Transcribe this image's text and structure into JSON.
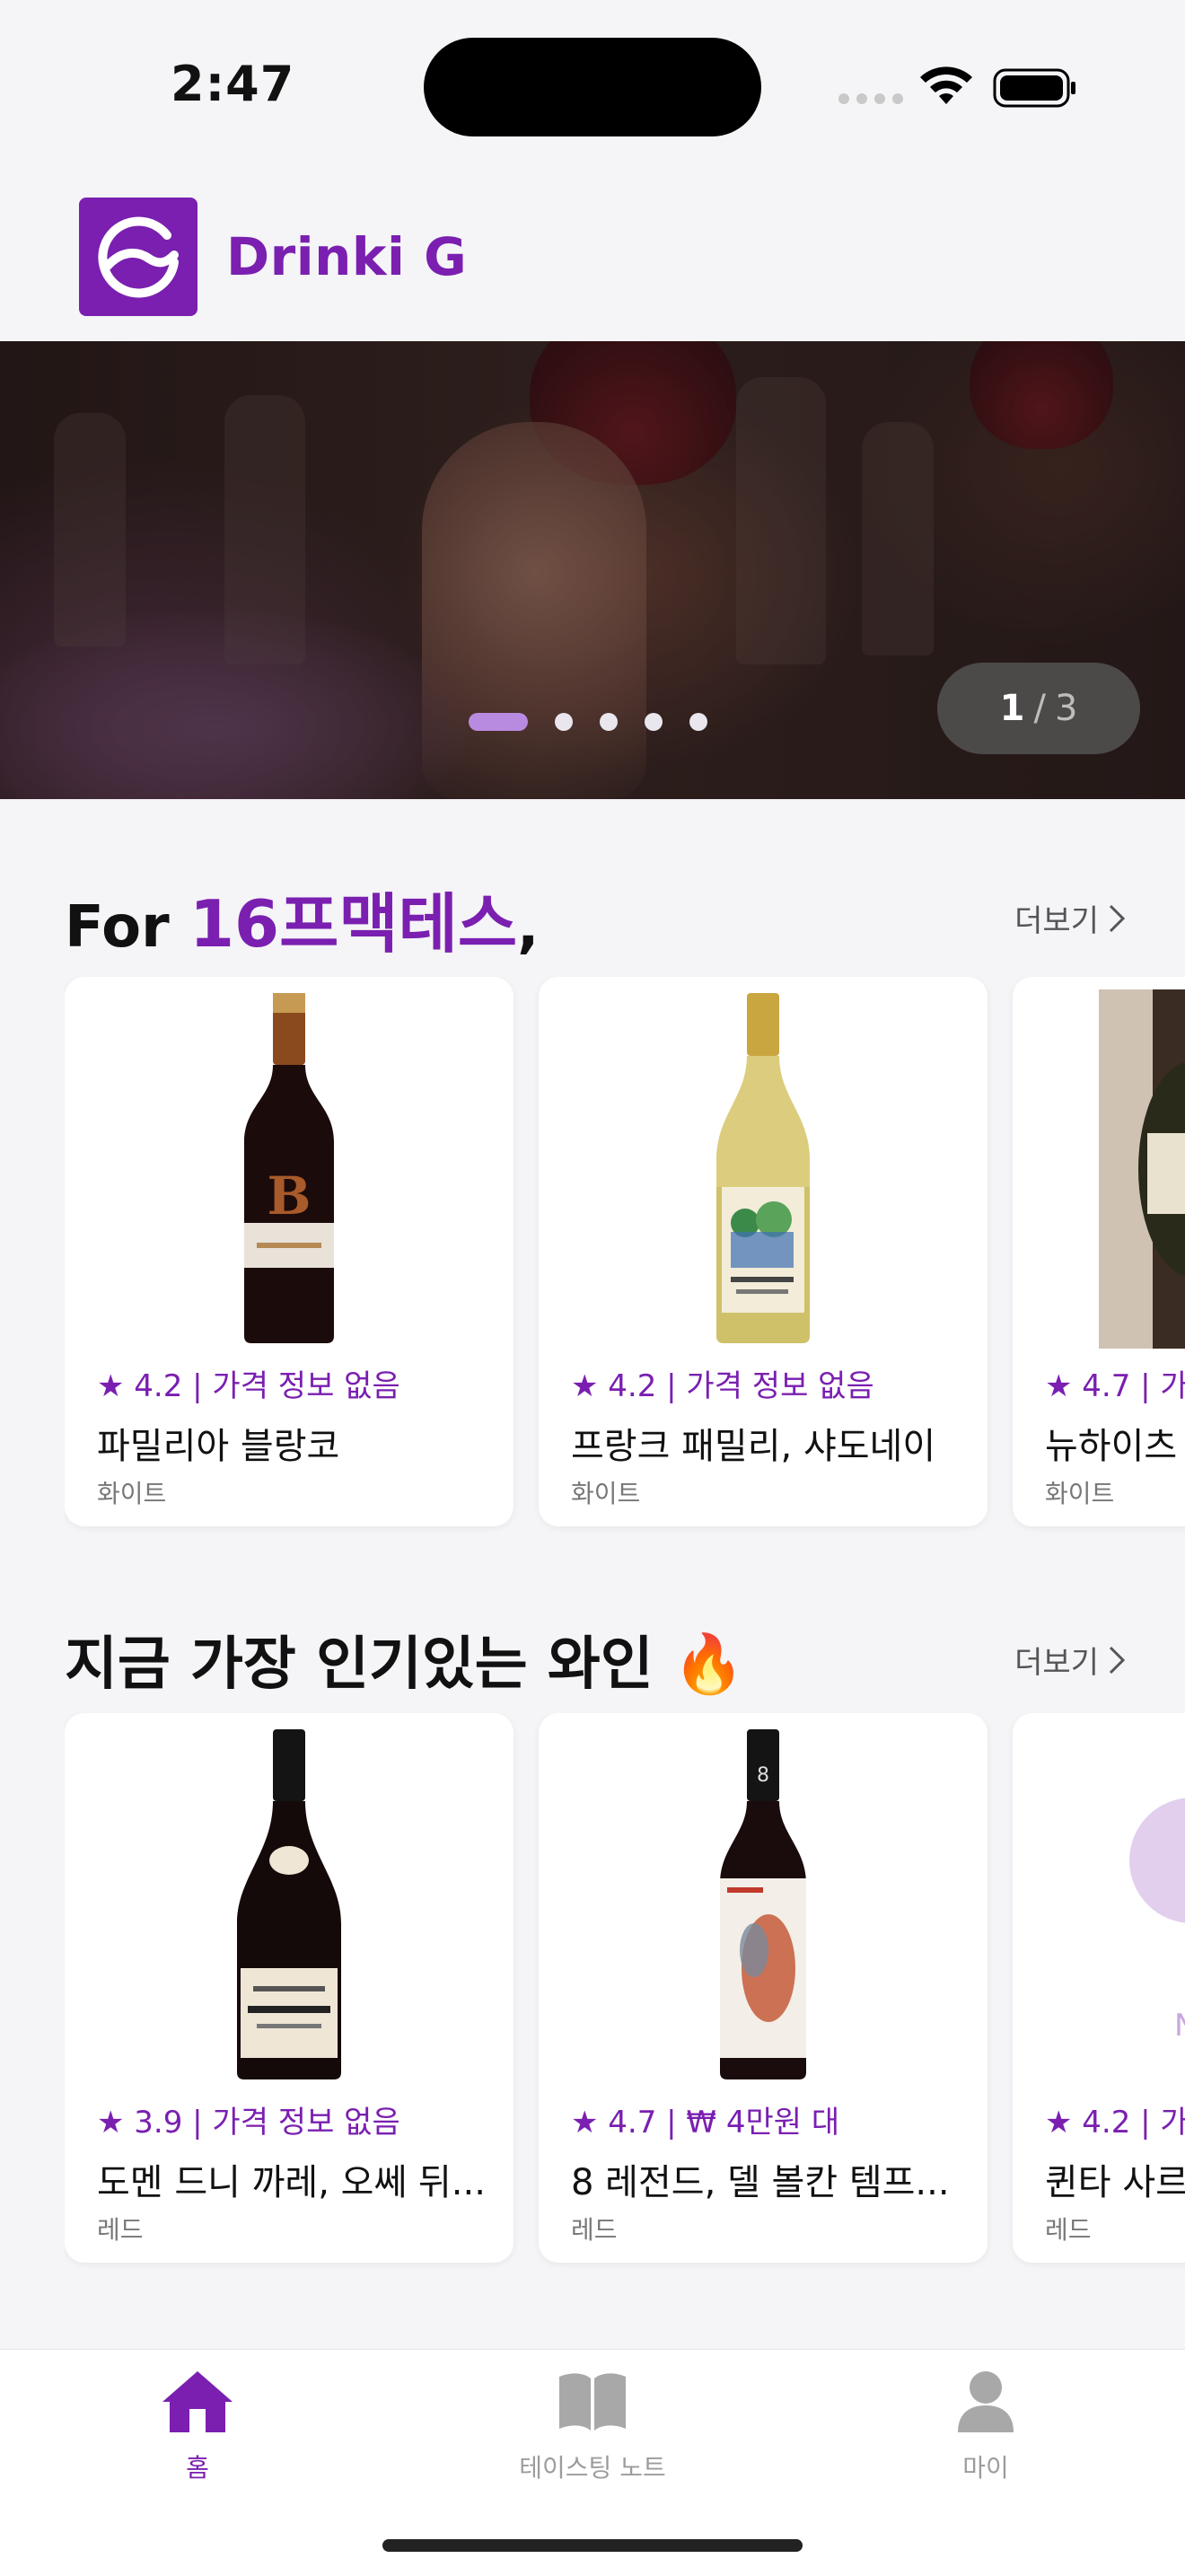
{
  "status_bar": {
    "time": "2:47"
  },
  "header": {
    "brand": "Drinki G",
    "brand_color": "#7a1fb0"
  },
  "banner": {
    "current": "1",
    "separator": "/",
    "total": "3",
    "dots": 5,
    "active_dot": 0
  },
  "section_recommend": {
    "title_prefix": "For ",
    "title_name": "16프맥테스",
    "title_suffix": ",",
    "more_label": "더보기",
    "cards": [
      {
        "meta": "★ 4.2  |  가격 정보 없음",
        "name": "파밀리아 블랑코",
        "type": "화이트",
        "label": "red-bottle"
      },
      {
        "meta": "★ 4.2  |  가격 정보 없음",
        "name": "프랑크 패밀리, 샤도네이",
        "type": "화이트",
        "label": "white-bottle"
      },
      {
        "meta": "★ 4.7  |  가",
        "name": "뉴하이츠",
        "type": "화이트",
        "label": "photo"
      }
    ]
  },
  "section_popular": {
    "title": "지금 가장 인기있는 와인 🔥",
    "more_label": "더보기",
    "cards": [
      {
        "meta": "★ 3.9  |  가격 정보 없음",
        "name": "도멘 드니 까레, 오쎄 뒤...",
        "type": "레드",
        "label": "burgundy-bottle"
      },
      {
        "meta": "★ 4.7  |  ₩ 4만원 대",
        "name": "8 레전드, 델 볼칸 템프...",
        "type": "레드",
        "label": "art-bottle"
      },
      {
        "meta": "★ 4.2  |  가",
        "name": "퀸타 사르",
        "type": "레드",
        "label": "placeholder"
      }
    ]
  },
  "tab_bar": {
    "tabs": [
      {
        "label": "홈",
        "icon": "home-icon",
        "active": true
      },
      {
        "label": "테이스팅 노트",
        "icon": "book-icon",
        "active": false
      },
      {
        "label": "마이",
        "icon": "person-icon",
        "active": false
      }
    ]
  }
}
